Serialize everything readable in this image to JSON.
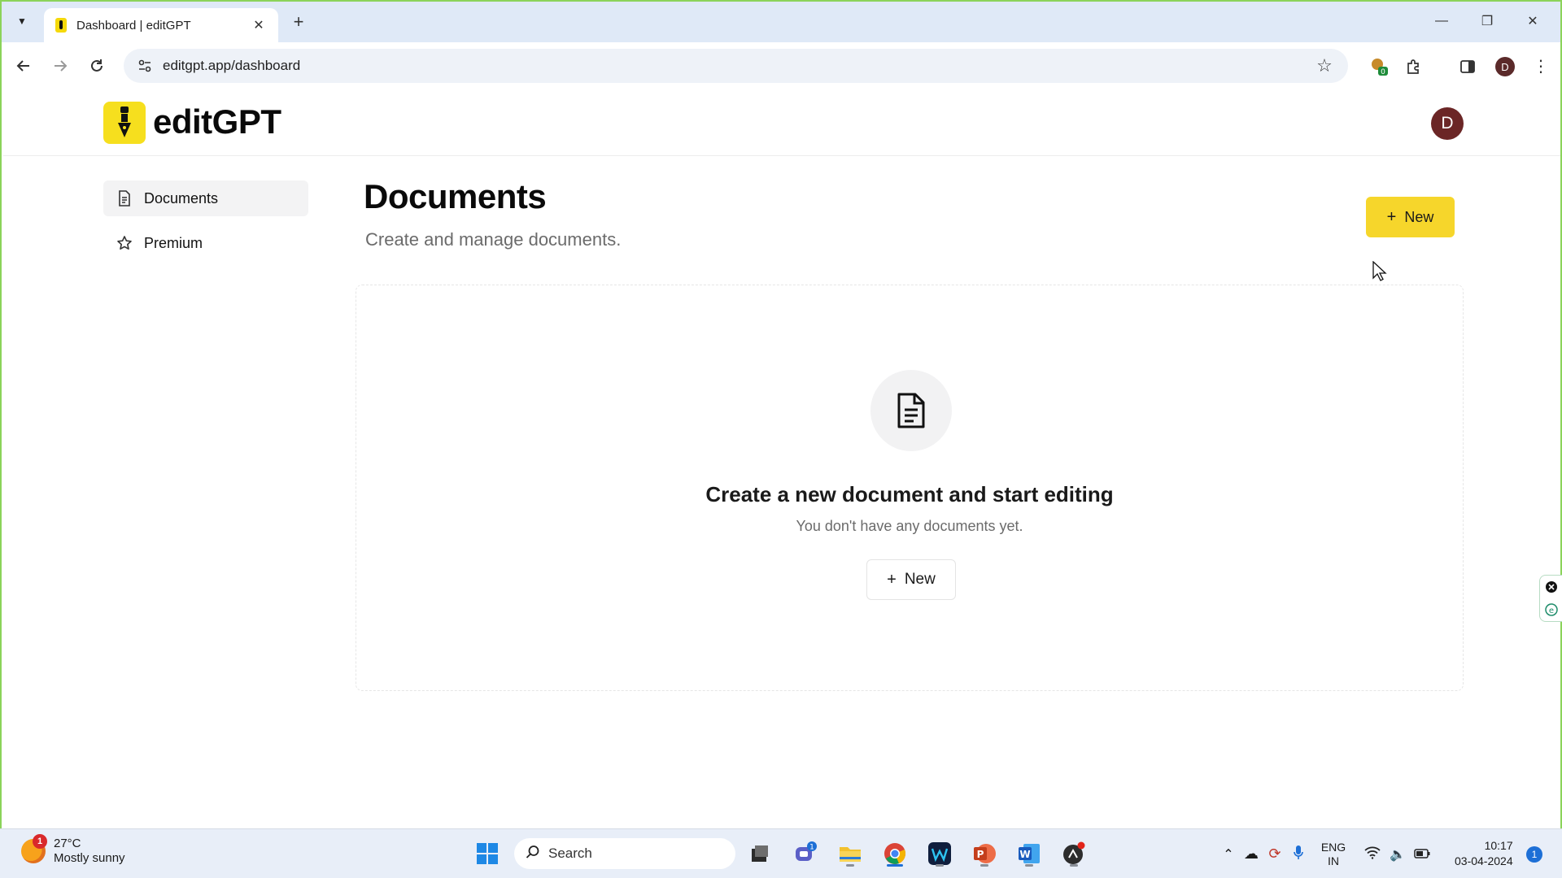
{
  "browser": {
    "tab_title": "Dashboard | editGPT",
    "url": "editgpt.app/dashboard",
    "profile_initial": "D",
    "extension_badge": "0"
  },
  "app": {
    "logo_text": "editGPT",
    "avatar_initial": "D",
    "brand_color": "#f6df1e"
  },
  "sidebar": {
    "items": [
      {
        "label": "Documents",
        "icon": "document-icon",
        "active": true
      },
      {
        "label": "Premium",
        "icon": "star-icon",
        "active": false
      }
    ]
  },
  "main": {
    "title": "Documents",
    "subtitle": "Create and manage documents.",
    "new_button_label": "New"
  },
  "empty_state": {
    "heading": "Create a new document and start editing",
    "subtext": "You don't have any documents yet.",
    "button_label": "New"
  },
  "taskbar": {
    "weather_temp": "27°C",
    "weather_desc": "Mostly sunny",
    "weather_badge": "1",
    "search_placeholder": "Search",
    "teams_badge": "1",
    "language_top": "ENG",
    "language_bottom": "IN",
    "time": "10:17",
    "date": "03-04-2024",
    "notification_count": "1"
  }
}
